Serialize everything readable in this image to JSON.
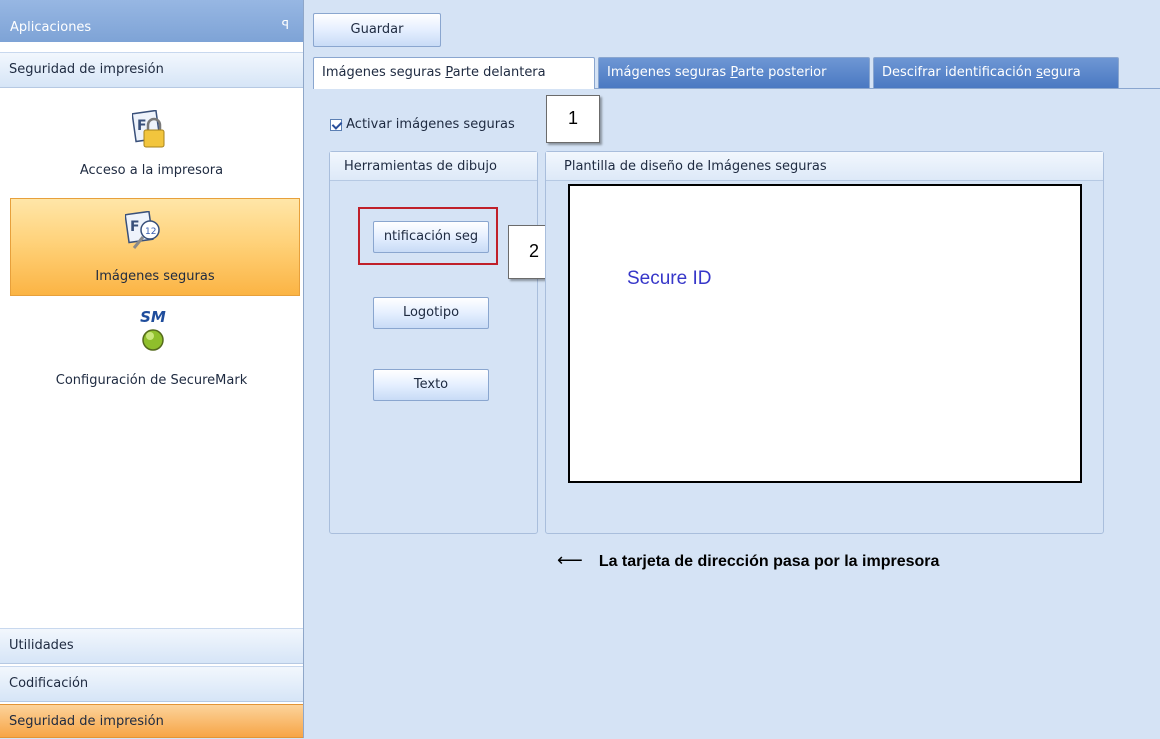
{
  "sidebar": {
    "header_title": "Aplicaciones",
    "pin_glyph": "ꟼ",
    "top_group": "Seguridad de impresión",
    "items": [
      {
        "label": "Acceso a la impresora",
        "icon": "lock-card-icon"
      },
      {
        "label": "Imágenes seguras",
        "icon": "secure-image-card-icon"
      },
      {
        "label": "Configuración de SecureMark",
        "icon": "securemark-icon",
        "badge": "SM"
      }
    ],
    "groups": [
      "Utilidades",
      "Codificación",
      "Seguridad de impresión"
    ]
  },
  "toolbar": {
    "save_label": "Guardar"
  },
  "tabs": [
    {
      "pre": "Imágenes seguras ",
      "key": "P",
      "post": "arte delantera"
    },
    {
      "pre": "Imágenes seguras ",
      "key": "P",
      "post": "arte posterior"
    },
    {
      "pre": "Descifrar identificación ",
      "key": "s",
      "post": "egura"
    }
  ],
  "panel": {
    "enable_label": "Activar imágenes seguras",
    "enable_checked": true,
    "tools_title": "Herramientas de dibujo",
    "tools": [
      "ntificación seg",
      "Logotipo",
      "Texto"
    ],
    "template_title": "Plantilla de diseño de Imágenes seguras",
    "canvas_text": "Secure ID"
  },
  "callouts": [
    "1",
    "2"
  ],
  "note": {
    "arrow": "⟵",
    "text": "La tarjeta de dirección pasa por la impresora"
  },
  "colors": {
    "selected_item": "#fbb444",
    "active_tab_inactive": "#4a79c2",
    "highlight_box": "#c0202a",
    "canvas_text": "#3737c9"
  }
}
